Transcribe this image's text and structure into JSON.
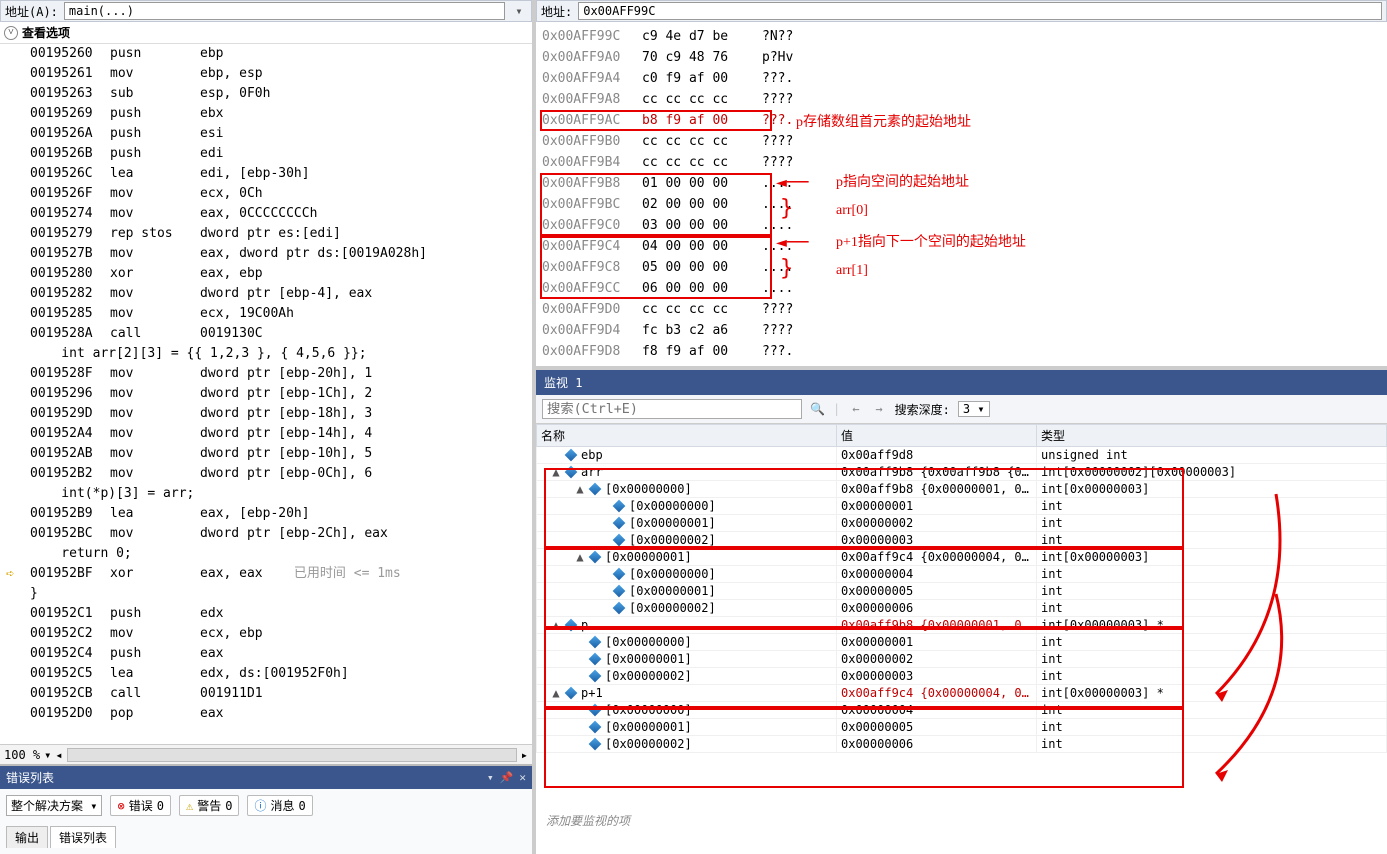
{
  "left": {
    "addr_label": "地址(A):",
    "addr_value": "main(...)",
    "view_opts": "查看选项",
    "zoom": "100 %",
    "disasm": [
      {
        "a": "00195260",
        "op": "pusn",
        "args": "ebp"
      },
      {
        "a": "00195261",
        "op": "mov",
        "args": "ebp, esp"
      },
      {
        "a": "00195263",
        "op": "sub",
        "args": "esp, 0F0h"
      },
      {
        "a": "00195269",
        "op": "push",
        "args": "ebx"
      },
      {
        "a": "0019526A",
        "op": "push",
        "args": "esi"
      },
      {
        "a": "0019526B",
        "op": "push",
        "args": "edi"
      },
      {
        "a": "0019526C",
        "op": "lea",
        "args": "edi, [ebp-30h]"
      },
      {
        "a": "0019526F",
        "op": "mov",
        "args": "ecx, 0Ch"
      },
      {
        "a": "00195274",
        "op": "mov",
        "args": "eax, 0CCCCCCCCh"
      },
      {
        "a": "00195279",
        "op": "rep stos",
        "args": "dword ptr es:[edi]"
      },
      {
        "a": "0019527B",
        "op": "mov",
        "args": "eax, dword ptr ds:[0019A028h]"
      },
      {
        "a": "00195280",
        "op": "xor",
        "args": "eax, ebp"
      },
      {
        "a": "00195282",
        "op": "mov",
        "args": "dword ptr [ebp-4], eax"
      },
      {
        "a": "00195285",
        "op": "mov",
        "args": "ecx, 19C00Ah"
      },
      {
        "a": "0019528A",
        "op": "call",
        "args": "0019130C"
      },
      {
        "a": "",
        "op": "",
        "args": "    int arr[2][3] = {{ 1,2,3 }, { 4,5,6 }};"
      },
      {
        "a": "0019528F",
        "op": "mov",
        "args": "dword ptr [ebp-20h], 1"
      },
      {
        "a": "00195296",
        "op": "mov",
        "args": "dword ptr [ebp-1Ch], 2"
      },
      {
        "a": "0019529D",
        "op": "mov",
        "args": "dword ptr [ebp-18h], 3"
      },
      {
        "a": "001952A4",
        "op": "mov",
        "args": "dword ptr [ebp-14h], 4"
      },
      {
        "a": "001952AB",
        "op": "mov",
        "args": "dword ptr [ebp-10h], 5"
      },
      {
        "a": "001952B2",
        "op": "mov",
        "args": "dword ptr [ebp-0Ch], 6"
      },
      {
        "a": "",
        "op": "",
        "args": "    int(*p)[3] = arr;"
      },
      {
        "a": "001952B9",
        "op": "lea",
        "args": "eax, [ebp-20h]"
      },
      {
        "a": "001952BC",
        "op": "mov",
        "args": "dword ptr [ebp-2Ch], eax"
      },
      {
        "a": "",
        "op": "",
        "args": "    return 0;"
      },
      {
        "a": "001952BF",
        "op": "xor",
        "args": "eax, eax",
        "timing": "已用时间 <= 1ms",
        "cur": true
      },
      {
        "a": "",
        "op": "",
        "args": "}"
      },
      {
        "a": "001952C1",
        "op": "push",
        "args": "edx"
      },
      {
        "a": "001952C2",
        "op": "mov",
        "args": "ecx, ebp"
      },
      {
        "a": "001952C4",
        "op": "push",
        "args": "eax"
      },
      {
        "a": "001952C5",
        "op": "lea",
        "args": "edx, ds:[001952F0h]"
      },
      {
        "a": "001952CB",
        "op": "call",
        "args": "001911D1"
      },
      {
        "a": "001952D0",
        "op": "pop",
        "args": "eax"
      }
    ]
  },
  "err": {
    "title": "错误列表",
    "scope": "整个解决方案",
    "errors_lbl": "错误",
    "errors_n": "0",
    "warns_lbl": "警告",
    "warns_n": "0",
    "msgs_lbl": "消息",
    "msgs_n": "0",
    "tab_output": "输出",
    "tab_errors": "错误列表"
  },
  "mem": {
    "addr_label": "地址:",
    "addr_value": "0x00AFF99C",
    "rows": [
      {
        "a": "0x00AFF99C",
        "h": "c9 4e d7 be",
        "s": "?N??"
      },
      {
        "a": "0x00AFF9A0",
        "h": "70 c9 48 76",
        "s": "p?Hv"
      },
      {
        "a": "0x00AFF9A4",
        "h": "c0 f9 af 00",
        "s": "???."
      },
      {
        "a": "0x00AFF9A8",
        "h": "cc cc cc cc",
        "s": "????"
      },
      {
        "a": "0x00AFF9AC",
        "h": "b8 f9 af 00",
        "s": "???.",
        "red": true
      },
      {
        "a": "0x00AFF9B0",
        "h": "cc cc cc cc",
        "s": "????"
      },
      {
        "a": "0x00AFF9B4",
        "h": "cc cc cc cc",
        "s": "????"
      },
      {
        "a": "0x00AFF9B8",
        "h": "01 00 00 00",
        "s": "...."
      },
      {
        "a": "0x00AFF9BC",
        "h": "02 00 00 00",
        "s": "...."
      },
      {
        "a": "0x00AFF9C0",
        "h": "03 00 00 00",
        "s": "...."
      },
      {
        "a": "0x00AFF9C4",
        "h": "04 00 00 00",
        "s": "...."
      },
      {
        "a": "0x00AFF9C8",
        "h": "05 00 00 00",
        "s": "...."
      },
      {
        "a": "0x00AFF9CC",
        "h": "06 00 00 00",
        "s": "...."
      },
      {
        "a": "0x00AFF9D0",
        "h": "cc cc cc cc",
        "s": "????"
      },
      {
        "a": "0x00AFF9D4",
        "h": "fc b3 c2 a6",
        "s": "????"
      },
      {
        "a": "0x00AFF9D8",
        "h": "f8 f9 af 00",
        "s": "???."
      }
    ],
    "annos": {
      "p_store": "p存储数组首元素的起始地址",
      "p_point": "p指向空间的起始地址",
      "arr0": "arr[0]",
      "p_plus": "p+1指向下一个空间的起始地址",
      "arr1": "arr[1]"
    }
  },
  "watch": {
    "title": "监视 1",
    "search_ph": "搜索(Ctrl+E)",
    "depth_lbl": "搜索深度:",
    "depth_val": "3",
    "col_name": "名称",
    "col_val": "值",
    "col_type": "类型",
    "hint": "添加要监视的项",
    "rows": [
      {
        "d": 1,
        "exp": "",
        "n": "ebp",
        "v": "0x00aff9d8",
        "t": "unsigned int"
      },
      {
        "d": 1,
        "exp": "▲",
        "n": "arr",
        "v": "0x00aff9b8 {0x00aff9b8 {0x...",
        "t": "int[0x00000002][0x00000003]"
      },
      {
        "d": 2,
        "exp": "▲",
        "n": "[0x00000000]",
        "v": "0x00aff9b8 {0x00000001, 0...",
        "t": "int[0x00000003]",
        "box": "a0"
      },
      {
        "d": 3,
        "exp": "",
        "n": "[0x00000000]",
        "v": "0x00000001",
        "t": "int"
      },
      {
        "d": 3,
        "exp": "",
        "n": "[0x00000001]",
        "v": "0x00000002",
        "t": "int"
      },
      {
        "d": 3,
        "exp": "",
        "n": "[0x00000002]",
        "v": "0x00000003",
        "t": "int"
      },
      {
        "d": 2,
        "exp": "▲",
        "n": "[0x00000001]",
        "v": "0x00aff9c4 {0x00000004, 0x...",
        "t": "int[0x00000003]",
        "box": "a1"
      },
      {
        "d": 3,
        "exp": "",
        "n": "[0x00000000]",
        "v": "0x00000004",
        "t": "int"
      },
      {
        "d": 3,
        "exp": "",
        "n": "[0x00000001]",
        "v": "0x00000005",
        "t": "int"
      },
      {
        "d": 3,
        "exp": "",
        "n": "[0x00000002]",
        "v": "0x00000006",
        "t": "int"
      },
      {
        "d": 1,
        "exp": "▲",
        "n": "p",
        "v": "0x00aff9b8 {0x00000001, 0...",
        "t": "int[0x00000003] *",
        "red": true,
        "box": "p"
      },
      {
        "d": 2,
        "exp": "",
        "n": "[0x00000000]",
        "v": "0x00000001",
        "t": "int"
      },
      {
        "d": 2,
        "exp": "",
        "n": "[0x00000001]",
        "v": "0x00000002",
        "t": "int"
      },
      {
        "d": 2,
        "exp": "",
        "n": "[0x00000002]",
        "v": "0x00000003",
        "t": "int"
      },
      {
        "d": 1,
        "exp": "▲",
        "n": "p+1",
        "v": "0x00aff9c4 {0x00000004, 0x...",
        "t": "int[0x00000003] *",
        "red": true,
        "box": "p1"
      },
      {
        "d": 2,
        "exp": "",
        "n": "[0x00000000]",
        "v": "0x00000004",
        "t": "int"
      },
      {
        "d": 2,
        "exp": "",
        "n": "[0x00000001]",
        "v": "0x00000005",
        "t": "int"
      },
      {
        "d": 2,
        "exp": "",
        "n": "[0x00000002]",
        "v": "0x00000006",
        "t": "int"
      }
    ]
  }
}
